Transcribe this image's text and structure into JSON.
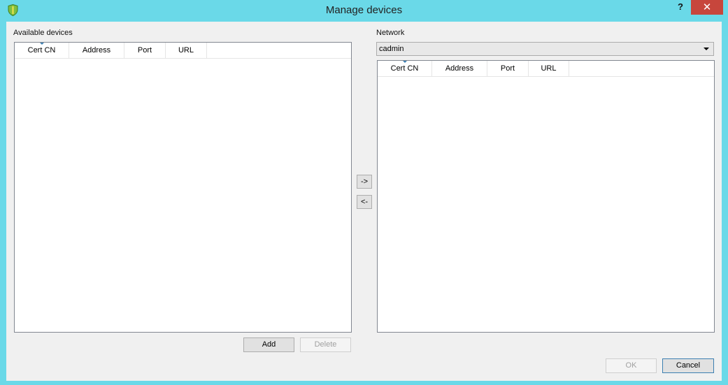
{
  "window": {
    "title": "Manage devices",
    "help_label": "?",
    "close_label": "✕"
  },
  "available": {
    "label": "Available devices",
    "columns": [
      "Cert CN",
      "Address",
      "Port",
      "URL"
    ],
    "add_label": "Add",
    "delete_label": "Delete"
  },
  "network": {
    "label": "Network",
    "selected": "cadmin",
    "columns": [
      "Cert CN",
      "Address",
      "Port",
      "URL"
    ]
  },
  "transfer": {
    "right_label": "->",
    "left_label": "<-"
  },
  "footer": {
    "ok_label": "OK",
    "cancel_label": "Cancel"
  },
  "colors": {
    "frame": "#6ad9e8",
    "close": "#c7463c",
    "sort_indicator": "#3c7fb1"
  },
  "icons": {
    "app": "shield-icon",
    "dropdown": "chevron-down-icon"
  }
}
